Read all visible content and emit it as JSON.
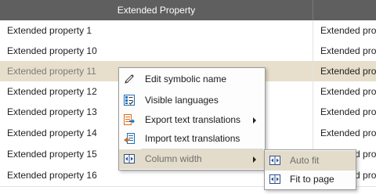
{
  "header": {
    "column_1": "Extended Property",
    "column_2": ""
  },
  "rows": [
    {
      "name": "Extended property 1",
      "value": "Extended prope"
    },
    {
      "name": "Extended property 10",
      "value": "Extended prope"
    },
    {
      "name": "Extended property 11",
      "value": "Extended prope"
    },
    {
      "name": "Extended property 12",
      "value": "Extended prope"
    },
    {
      "name": "Extended property 13",
      "value": "Extended prope"
    },
    {
      "name": "Extended property 14",
      "value": "Extended prope"
    },
    {
      "name": "Extended property 15",
      "value": "Extended prope"
    },
    {
      "name": "Extended property 16",
      "value": "Extended prope"
    }
  ],
  "selected_row": 2,
  "context_menu": {
    "items": [
      {
        "label": "Edit symbolic name",
        "icon": "pencil-icon"
      },
      {
        "label": "Visible languages",
        "icon": "checklist-icon"
      },
      {
        "label": "Export text translations",
        "icon": "export-icon",
        "has_submenu": true
      },
      {
        "label": "Import text translations",
        "icon": "import-icon"
      },
      {
        "label": "Column width",
        "icon": "column-width-icon",
        "has_submenu": true,
        "hovered": true
      }
    ]
  },
  "submenu": {
    "items": [
      {
        "label": "Auto fit",
        "icon": "column-width-icon",
        "hovered": true
      },
      {
        "label": "Fit to page",
        "icon": "column-width-icon"
      }
    ]
  },
  "colors": {
    "header_bg": "#5f5f5f",
    "selected_row_bg": "#e7dfcb",
    "menu_hover_bg": "#e3dccb",
    "icon_blue": "#1f6fb5",
    "icon_orange": "#e06a18"
  }
}
